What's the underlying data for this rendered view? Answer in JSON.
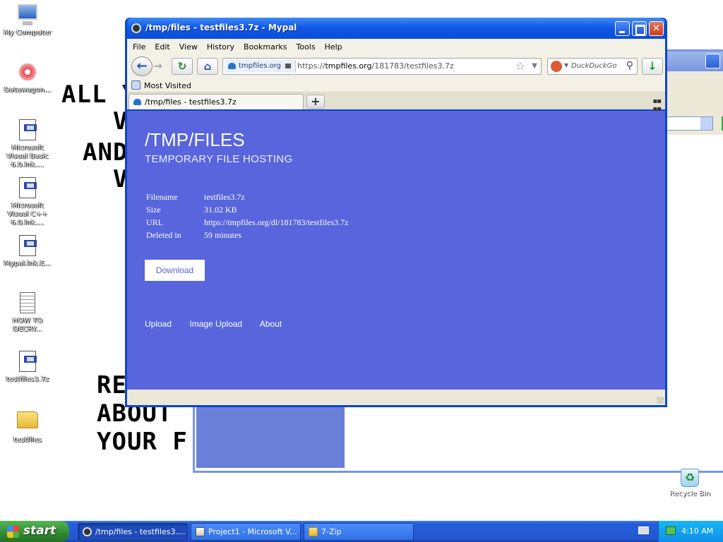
{
  "desktop": {
    "wallpaper_text": [
      "ALL Y",
      "V",
      "AND",
      "V",
      "RE",
      "ABOUT",
      "YOUR F"
    ],
    "icons": [
      {
        "label": "My Computer",
        "icon": "computer-icon"
      },
      {
        "label": "Datawagon...",
        "icon": "flower-shortcut-icon"
      },
      {
        "label": "Microsoft Visual Basic 6.0.lnk....",
        "icon": "vb-document-icon"
      },
      {
        "label": "Microsoft Visual C++ 6.0.lnk....",
        "icon": "vc-document-icon"
      },
      {
        "label": "Mypal.lnk.E...",
        "icon": "shortcut-document-icon"
      },
      {
        "label": "HOW TO DECRY...",
        "icon": "text-file-icon"
      },
      {
        "label": "testfiles3.7z",
        "icon": "archive-file-icon"
      },
      {
        "label": "testfiles",
        "icon": "folder-icon"
      }
    ],
    "recycle_bin": "Recycle Bin"
  },
  "browser": {
    "window_title": "/tmp/files - testfiles3.7z - Mypal",
    "menu": [
      "File",
      "Edit",
      "View",
      "History",
      "Bookmarks",
      "Tools",
      "Help"
    ],
    "identity_host": "tmpfiles.org",
    "url_prefix": "https://",
    "url_host": "tmpfiles.org",
    "url_path": "/181783/testfiles3.7z",
    "search_placeholder": "DuckDuckGo",
    "bookmark": "Most Visited",
    "tab_title": "/tmp/files - testfiles3.7z",
    "new_tab": "+"
  },
  "page": {
    "title": "/TMP/FILES",
    "subtitle": "TEMPORARY FILE HOSTING",
    "fields": [
      {
        "key": "Filename",
        "value": "testfiles3.7z"
      },
      {
        "key": "Size",
        "value": "31.02 KB"
      },
      {
        "key": "URL",
        "value": "https://tmpfiles.org/dl/181783/testfiles3.7z"
      },
      {
        "key": "Deleted in",
        "value": "59 minutes"
      }
    ],
    "download_label": "Download",
    "nav": [
      "Upload",
      "Image Upload",
      "About"
    ]
  },
  "taskbar": {
    "start": "start",
    "tasks": [
      "/tmp/files - testfiles3....",
      "Project1 - Microsoft V...",
      "7-Zip"
    ],
    "clock": "4:10 AM"
  },
  "colors": {
    "page_bg": "#5865dd",
    "title_bar": "#0a4cd7",
    "taskbar": "#245edb"
  }
}
